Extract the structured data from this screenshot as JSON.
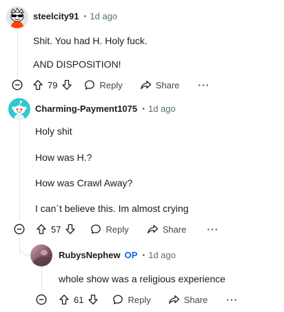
{
  "comments": [
    {
      "author": "steelcity91",
      "separator": "•",
      "time": "1d ago",
      "body": [
        "Shit. You had H. Holy fuck.",
        "AND DISPOSITION!"
      ],
      "score": "79",
      "reply_label": "Reply",
      "share_label": "Share",
      "more_label": "···"
    },
    {
      "author": "Charming-Payment1075",
      "separator": "•",
      "time": "1d ago",
      "body": [
        "Holy shit",
        "How was H.?",
        "How was Crawl Away?",
        "I can´t believe this. Im almost crying"
      ],
      "score": "57",
      "reply_label": "Reply",
      "share_label": "Share",
      "more_label": "···"
    },
    {
      "author": "RubysNephew",
      "op_badge": "OP",
      "separator": "•",
      "time": "1d ago",
      "body": [
        "whole show was a religious experience"
      ],
      "score": "61",
      "reply_label": "Reply",
      "share_label": "Share",
      "more_label": "···"
    }
  ],
  "colors": {
    "op": "#0a66d4",
    "thread_line": "#e2e5e8",
    "avatar2_bg": "#2fc8d0"
  }
}
